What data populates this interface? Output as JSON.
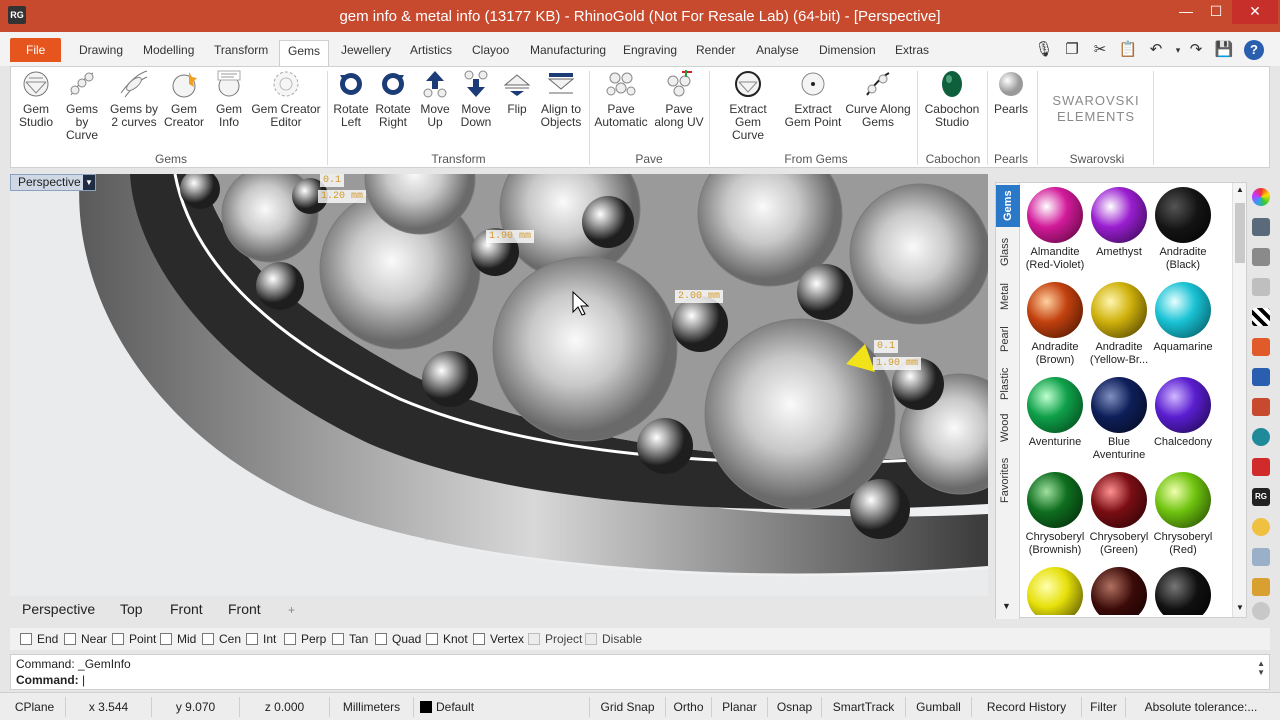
{
  "window": {
    "title": "gem info & metal info (13177 KB) - RhinoGold (Not For Resale Lab) (64-bit) - [Perspective]",
    "app_icon": "RG",
    "min": "—",
    "max": "☐",
    "close": "✕"
  },
  "tabs": [
    "Drawing",
    "Modelling",
    "Transform",
    "Gems",
    "Jewellery",
    "Artistics",
    "Clayoo",
    "Manufacturing",
    "Engraving",
    "Render",
    "Analyse",
    "Dimension",
    "Extras"
  ],
  "file_tab": "File",
  "quick_access": [
    "microphone-icon",
    "copy-icon",
    "cut-icon",
    "paste-icon",
    "undo-icon",
    "redo-icon",
    "save-icon",
    "help-icon"
  ],
  "ribbon": {
    "buttons": [
      {
        "l1": "Gem",
        "l2": "Studio"
      },
      {
        "l1": "Gems by",
        "l2": "Curve"
      },
      {
        "l1": "Gems by",
        "l2": "2 curves"
      },
      {
        "l1": "Gem",
        "l2": "Creator"
      },
      {
        "l1": "Gem",
        "l2": "Info"
      },
      {
        "l1": "Gem Creator",
        "l2": "Editor"
      },
      {
        "l1": "Rotate",
        "l2": "Left"
      },
      {
        "l1": "Rotate",
        "l2": "Right"
      },
      {
        "l1": "Move",
        "l2": "Up"
      },
      {
        "l1": "Move",
        "l2": "Down"
      },
      {
        "l1": "Flip",
        "l2": ""
      },
      {
        "l1": "Align to",
        "l2": "Objects"
      },
      {
        "l1": "Pave",
        "l2": "Automatic"
      },
      {
        "l1": "Pave",
        "l2": "along UV"
      },
      {
        "l1": "Extract Gem",
        "l2": "Curve"
      },
      {
        "l1": "Extract",
        "l2": "Gem Point"
      },
      {
        "l1": "Curve Along",
        "l2": "Gems"
      },
      {
        "l1": "Cabochon",
        "l2": "Studio"
      },
      {
        "l1": "Pearls",
        "l2": ""
      }
    ],
    "groups": [
      "Gems",
      "Transform",
      "Pave",
      "From Gems",
      "Cabochon",
      "Pearls",
      "Swarovski"
    ],
    "swarovski": {
      "l1": "SWAROVSKI",
      "l2": "ELEMENTS"
    }
  },
  "viewport": {
    "label": "Perspective",
    "dimensions": [
      "0.1",
      "1.20 mm",
      "1.90 mm",
      "2.00 mm",
      "0.1",
      "1.90 mm"
    ]
  },
  "view_tabs": [
    "Perspective",
    "Top",
    "Front",
    "Front",
    "+"
  ],
  "osnaps": [
    "End",
    "Near",
    "Point",
    "Mid",
    "Cen",
    "Int",
    "Perp",
    "Tan",
    "Quad",
    "Knot",
    "Vertex",
    "Project",
    "Disable"
  ],
  "command": {
    "history": "Command: _GemInfo",
    "prompt": "Command:"
  },
  "status": [
    "CPlane",
    "x 3.544",
    "y 9.070",
    "z 0.000",
    "Millimeters",
    "Default",
    "Grid Snap",
    "Ortho",
    "Planar",
    "Osnap",
    "SmartTrack",
    "Gumball",
    "Record History",
    "Filter",
    "Absolute tolerance:..."
  ],
  "panel": {
    "vtabs": [
      "Gems",
      "Glass",
      "Metal",
      "Pearl",
      "Plastic",
      "Wood",
      "Favorites"
    ],
    "gems": [
      {
        "l1": "Almandite",
        "l2": "(Red-Violet)",
        "color": "#d21a9a"
      },
      {
        "l1": "Amethyst",
        "l2": "",
        "color": "#9a1fd0"
      },
      {
        "l1": "Andradite",
        "l2": "(Black)",
        "color": "#141414"
      },
      {
        "l1": "Andradite",
        "l2": "(Brown)",
        "color": "#c2410f"
      },
      {
        "l1": "Andradite",
        "l2": "(Yellow-Br...",
        "color": "#cfb10c"
      },
      {
        "l1": "Aquamarine",
        "l2": "",
        "color": "#19c2d4"
      },
      {
        "l1": "Aventurine",
        "l2": "",
        "color": "#0fa04a"
      },
      {
        "l1": "Blue",
        "l2": "Aventurine",
        "color": "#0e1f5a"
      },
      {
        "l1": "Chalcedony",
        "l2": "",
        "color": "#5a1ed0"
      },
      {
        "l1": "Chrysoberyl",
        "l2": "(Brownish)",
        "color": "#0f6e1f"
      },
      {
        "l1": "Chrysoberyl",
        "l2": "(Green)",
        "color": "#7a0e14"
      },
      {
        "l1": "Chrysoberyl",
        "l2": "(Red)",
        "color": "#6fc30f"
      },
      {
        "l1": "",
        "l2": "",
        "color": "#e6e00a"
      },
      {
        "l1": "",
        "l2": "",
        "color": "#3a0a08"
      },
      {
        "l1": "",
        "l2": "",
        "color": "#101010"
      }
    ]
  }
}
